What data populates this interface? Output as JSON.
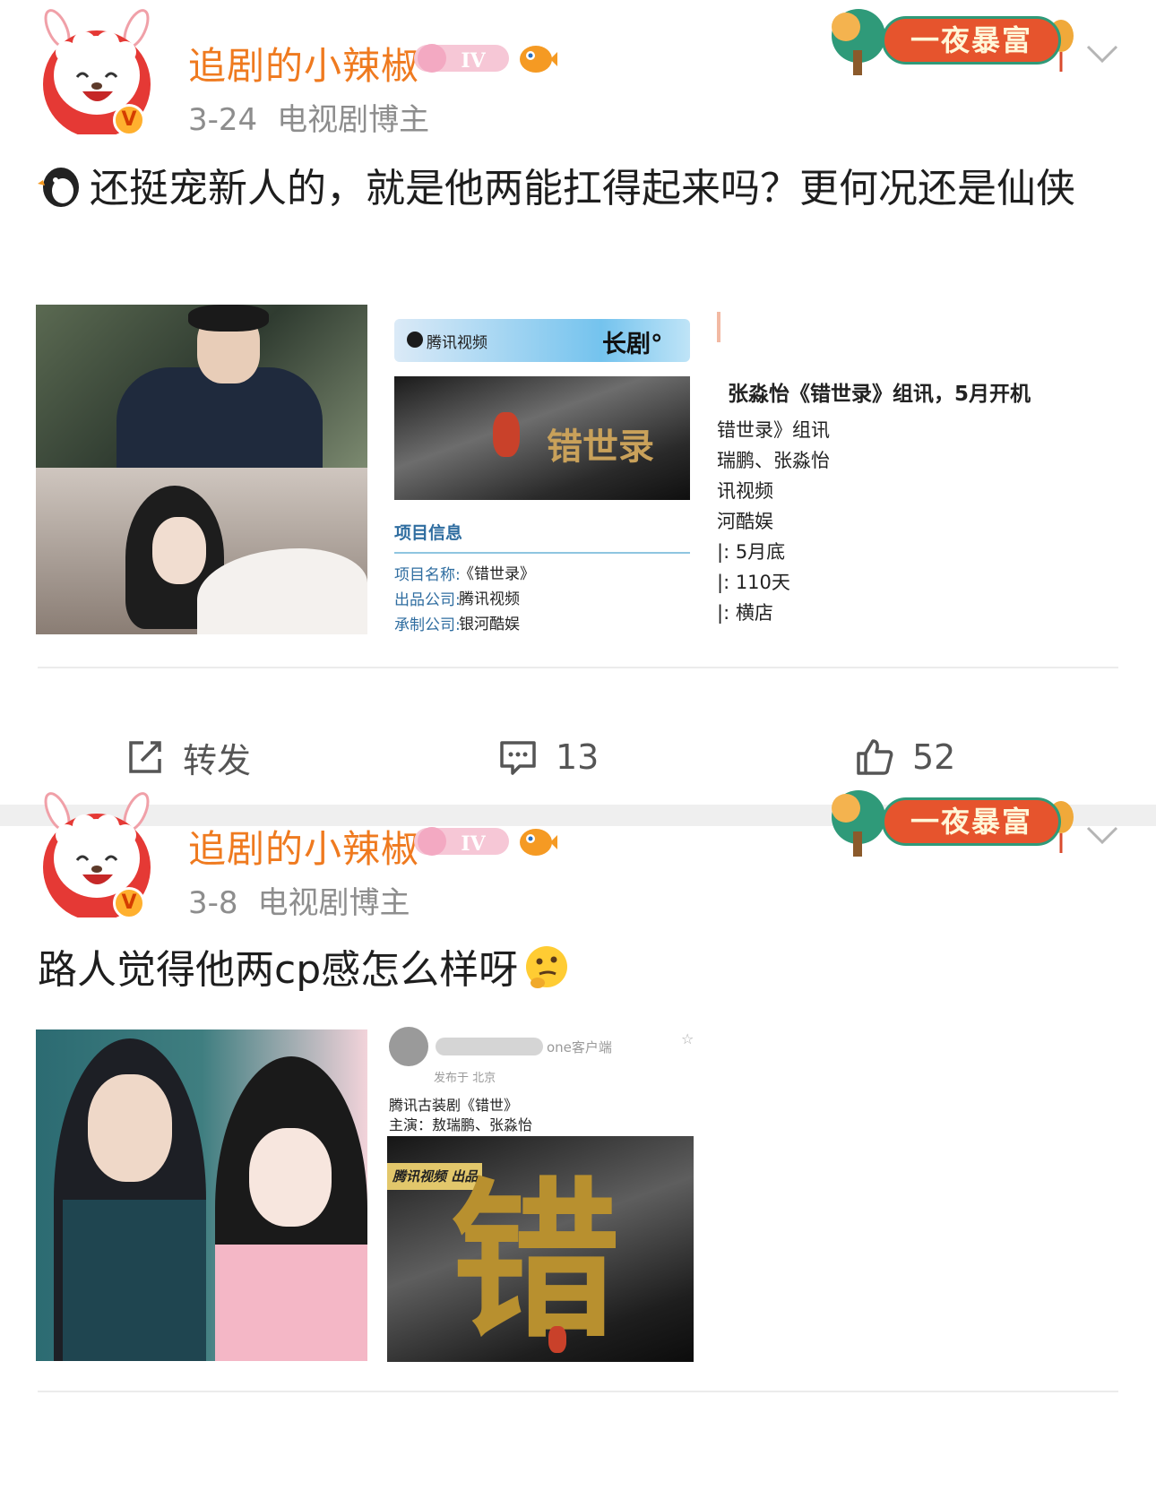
{
  "posts": [
    {
      "username": "追剧的小辣椒",
      "level_badge": "IV",
      "date": "3-24",
      "category": "电视剧博主",
      "fortune_banner": "一夜暴富",
      "text": "还挺宠新人的，就是他两能扛得起来吗？更何况还是仙侠",
      "images": {
        "card_top": {
          "brand": "腾讯视频",
          "tag": "长剧°",
          "title_art": "错世录",
          "section": "项目信息",
          "rows": [
            {
              "label": "项目名称:",
              "value": "《错世录》"
            },
            {
              "label": "出品公司:",
              "value": "腾讯视频"
            },
            {
              "label": "承制公司:",
              "value": "银河酷娱"
            }
          ]
        },
        "news": {
          "headline": "张淼怡《错世录》组讯，5月开机",
          "lines": [
            "错世录》组讯",
            "瑞鹏、张淼怡",
            "讯视频",
            "河酷娱",
            "|: 5月底",
            "|: 110天",
            "|: 横店"
          ]
        }
      },
      "actions": {
        "repost_label": "转发",
        "comment_count": "13",
        "like_count": "52"
      }
    },
    {
      "username": "追剧的小辣椒",
      "level_badge": "IV",
      "date": "3-8",
      "category": "电视剧博主",
      "fortune_banner": "一夜暴富",
      "text": "路人觉得他两cp感怎么样呀",
      "images": {
        "screenshot": {
          "client_text": "one客户端",
          "location": "发布于 北京",
          "line1": "腾讯古装剧《错世》",
          "line2": "主演：敖瑞鹏、张淼怡",
          "poster_brand": "腾讯视频 出品",
          "poster_title": "错"
        }
      }
    }
  ],
  "icons": {
    "repost": "repost-icon",
    "comment": "comment-icon",
    "like": "thumbs-up-icon",
    "chevron": "chevron-down-icon"
  },
  "colors": {
    "username": "#ef7a1f",
    "meta": "#8d8d8d",
    "separator": "#efefef"
  }
}
